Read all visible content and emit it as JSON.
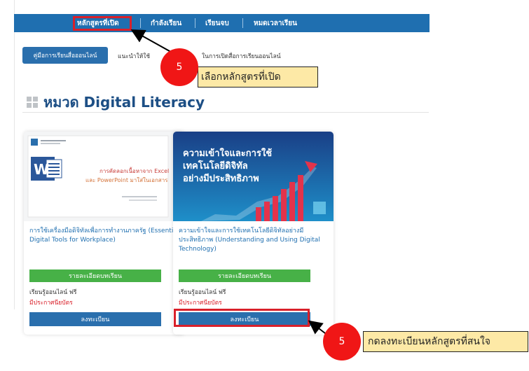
{
  "nav": {
    "items": [
      "หลักสูตรที่เปิด",
      "กำลังเรียน",
      "เรียนจบ",
      "หมดเวลาเรียน"
    ],
    "active_index": 0
  },
  "guide": {
    "button_label": "คู่มือการเรียนสื่อออนไลน์",
    "text_before": "แนะนำให้ใช้",
    "text_after": "ในการเปิดสื่อการเรียนออนไลน์"
  },
  "section": {
    "title": "หมวด Digital Literacy"
  },
  "courses": [
    {
      "thumb_lines": [
        "การคัดลอกเนื้อหาจาก Excel",
        "และ PowerPoint มาใส่ในเอกสาร"
      ],
      "title": "การใช้เครื่องมือดิจิทัลเพื่อการทำงานภาครัฐ (Essential Digital Tools for Workplace)",
      "detail_label": "รายละเอียดบทเรียน",
      "meta_free": "เรียนรู้ออนไลน์ ฟรี",
      "meta_cert": "มีประกาศนียบัตร",
      "register_label": "ลงทะเบียน"
    },
    {
      "thumb_lines": [
        "ความเข้าใจและการใช้",
        "เทคโนโลยีดิจิทัล",
        "อย่างมีประสิทธิภาพ"
      ],
      "title": "ความเข้าใจและการใช้เทคโนโลยีดิจิทัลอย่างมีประสิทธิภาพ (Understanding and Using Digital Technology)",
      "detail_label": "รายละเอียดบทเรียน",
      "meta_free": "เรียนรู้ออนไลน์ ฟรี",
      "meta_cert": "มีประกาศนียบัตร",
      "register_label": "ลงทะเบียน"
    }
  ],
  "callouts": [
    {
      "step": "5",
      "text": "เลือกหลักสูตรที่เปิด"
    },
    {
      "step": "5",
      "text": "กดลงทะเบียนหลักสูตรที่สนใจ"
    }
  ],
  "colors": {
    "nav_bg": "#1f6fb0",
    "highlight_red": "#d9202a",
    "badge_red": "#f01616",
    "note_bg": "#fde9a6",
    "detail_green": "#47b147",
    "register_blue": "#2a6fad"
  }
}
